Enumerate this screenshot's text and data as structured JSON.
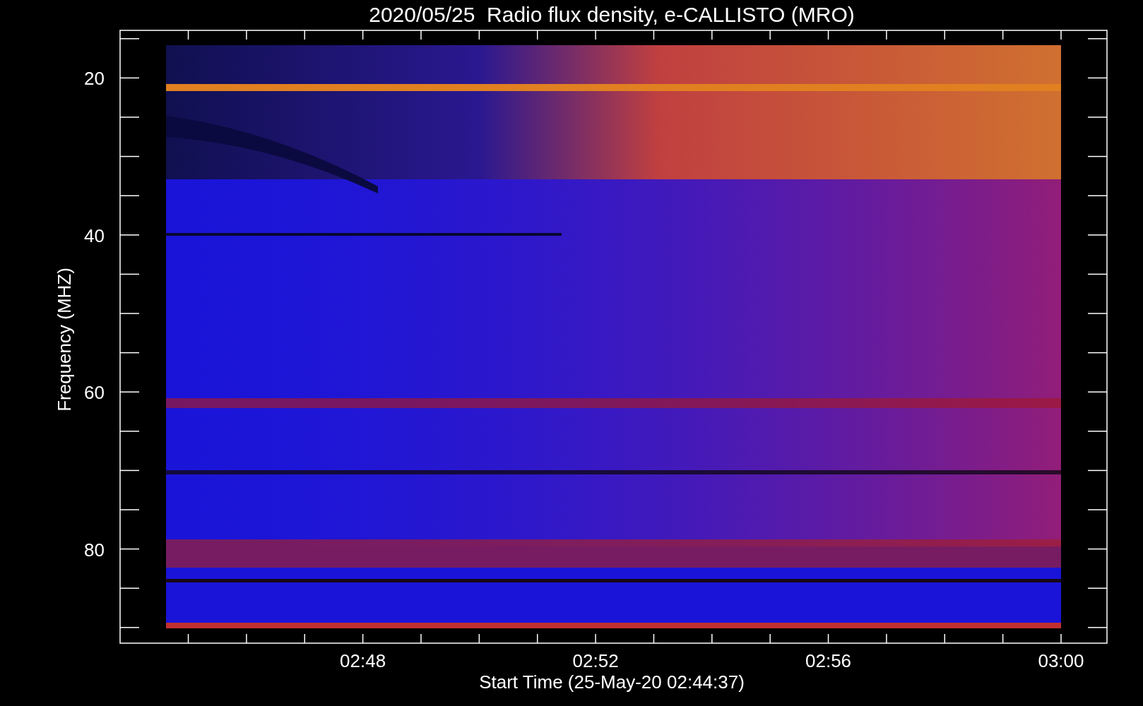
{
  "title": "2020/05/25  Radio flux density, e-CALLISTO (MRO)",
  "ylabel": "Frequency (MHZ)",
  "xlabel": "Start Time (25-May-20 02:44:37)",
  "yticks": [
    "20",
    "40",
    "60",
    "80"
  ],
  "xticks": [
    "02:48",
    "02:52",
    "02:56",
    "03:00"
  ]
}
